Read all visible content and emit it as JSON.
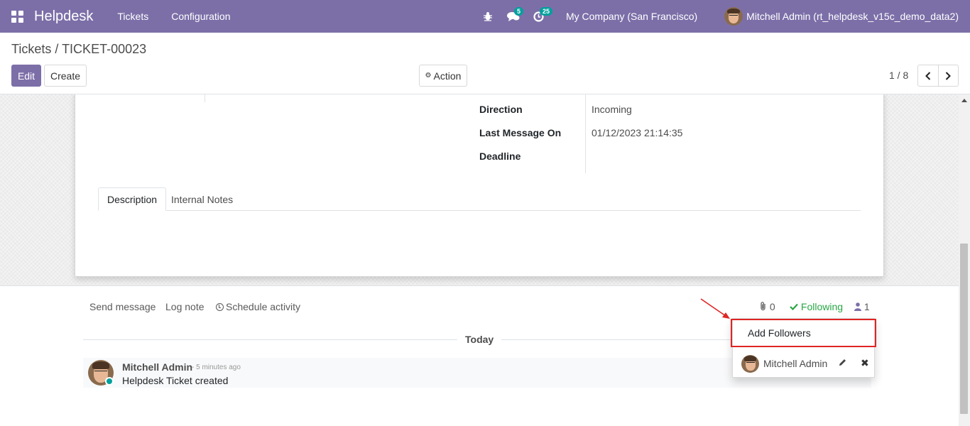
{
  "navbar": {
    "brand": "Helpdesk",
    "menu": [
      "Tickets",
      "Configuration"
    ],
    "messages_badge": "5",
    "activities_badge": "25",
    "company": "My Company (San Francisco)",
    "user": "Mitchell Admin (rt_helpdesk_v15c_demo_data2)"
  },
  "control_panel": {
    "breadcrumb_parent": "Tickets",
    "breadcrumb_separator": "/",
    "breadcrumb_current": "TICKET-00023",
    "edit_label": "Edit",
    "create_label": "Create",
    "action_label": "Action",
    "pager_value": "1 / 8"
  },
  "form": {
    "fields": [
      {
        "label": "Direction",
        "value": "Incoming"
      },
      {
        "label": "Last Message On",
        "value": "01/12/2023 21:14:35"
      },
      {
        "label": "Deadline",
        "value": ""
      }
    ],
    "tabs": [
      "Description",
      "Internal Notes"
    ]
  },
  "chatter": {
    "send_message": "Send message",
    "log_note": "Log note",
    "schedule_activity": "Schedule activity",
    "attachments_count": "0",
    "following_label": "Following",
    "followers_count": "1",
    "date_separator": "Today",
    "message": {
      "author": "Mitchell Admin",
      "time": "- 5 minutes ago",
      "body": "Helpdesk Ticket created"
    }
  },
  "followers_dropdown": {
    "add_followers": "Add Followers",
    "follower_name": "Mitchell Admin"
  },
  "colors": {
    "navbar": "#7c6fa8",
    "primary": "#7c6fa8",
    "badge": "#00a09d",
    "following": "#28a745",
    "highlight": "#e02424"
  }
}
